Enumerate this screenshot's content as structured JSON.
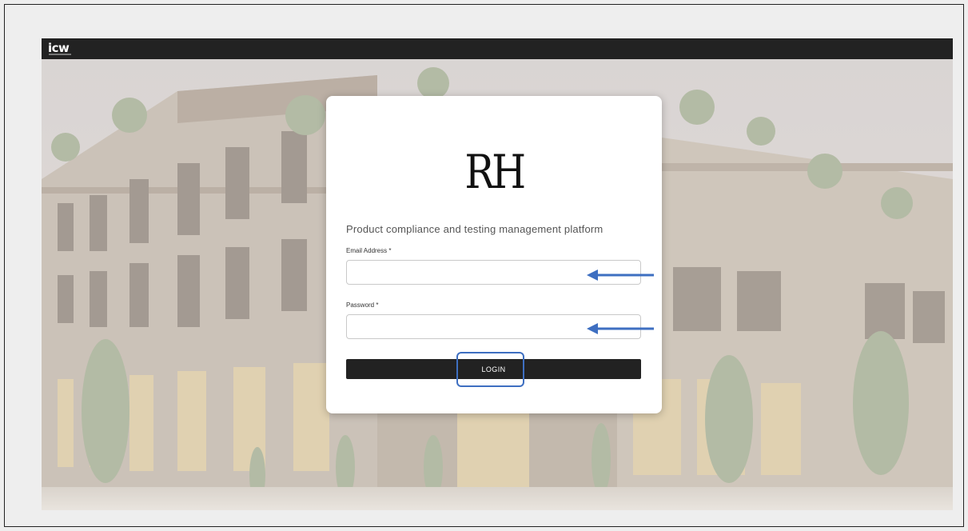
{
  "topbar": {
    "logo": "icw"
  },
  "login": {
    "brand_logo": "RH",
    "tagline": "Product compliance and testing management platform",
    "email_label": "Email Address *",
    "email_value": "",
    "password_label": "Password *",
    "password_value": "",
    "button_label": "LOGIN"
  },
  "colors": {
    "topbar": "#222222",
    "button": "#222222",
    "annotation": "#3e6fc1"
  }
}
